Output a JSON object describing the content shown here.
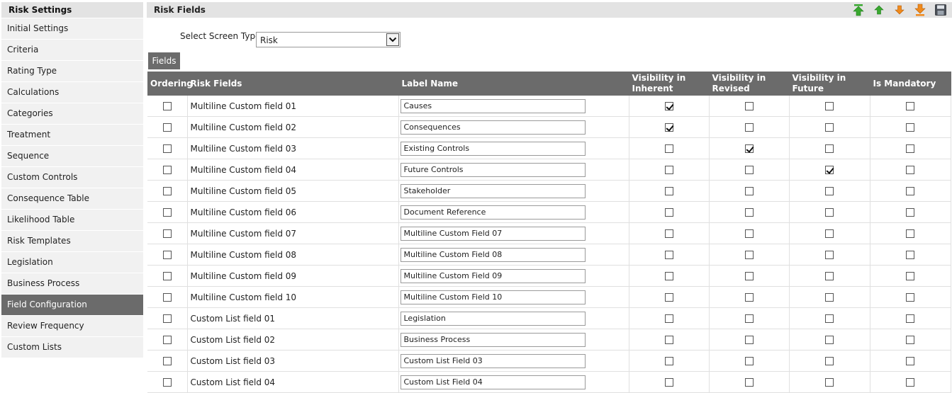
{
  "sidebar": {
    "title": "Risk Settings",
    "items": [
      {
        "label": "Initial Settings"
      },
      {
        "label": "Criteria"
      },
      {
        "label": "Rating Type"
      },
      {
        "label": "Calculations"
      },
      {
        "label": "Categories"
      },
      {
        "label": "Treatment"
      },
      {
        "label": "Sequence"
      },
      {
        "label": "Custom Controls"
      },
      {
        "label": "Consequence Table"
      },
      {
        "label": "Likelihood Table"
      },
      {
        "label": "Risk Templates"
      },
      {
        "label": "Legislation"
      },
      {
        "label": "Business Process"
      },
      {
        "label": "Field Configuration",
        "active": true
      },
      {
        "label": "Review Frequency"
      },
      {
        "label": "Custom Lists"
      }
    ]
  },
  "header": {
    "title": "Risk Fields",
    "toolbar_icons": [
      "move-top-icon",
      "move-up-icon",
      "move-down-icon",
      "move-bottom-icon",
      "save-icon"
    ]
  },
  "screen_type": {
    "label": "Select Screen Type :",
    "value": "Risk"
  },
  "tab": {
    "label": "Fields"
  },
  "table": {
    "headers": {
      "ordering": "Ordering",
      "risk_fields": "Risk Fields",
      "label_name": "Label Name",
      "vis_inherent": "Visibility in Inherent",
      "vis_revised": "Visibility in Revised",
      "vis_future": "Visibility in Future",
      "mandatory": "Is Mandatory"
    },
    "rows": [
      {
        "field": "Multiline Custom field 01",
        "label": "Causes",
        "inherent": true,
        "revised": false,
        "future": false,
        "mandatory": false
      },
      {
        "field": "Multiline Custom field 02",
        "label": "Consequences",
        "inherent": true,
        "revised": false,
        "future": false,
        "mandatory": false
      },
      {
        "field": "Multiline Custom field 03",
        "label": "Existing Controls",
        "inherent": false,
        "revised": true,
        "future": false,
        "mandatory": false
      },
      {
        "field": "Multiline Custom field 04",
        "label": "Future Controls",
        "inherent": false,
        "revised": false,
        "future": true,
        "mandatory": false
      },
      {
        "field": "Multiline Custom field 05",
        "label": "Stakeholder",
        "inherent": false,
        "revised": false,
        "future": false,
        "mandatory": false
      },
      {
        "field": "Multiline Custom field 06",
        "label": "Document Reference",
        "inherent": false,
        "revised": false,
        "future": false,
        "mandatory": false
      },
      {
        "field": "Multiline Custom field 07",
        "label": "Multiline Custom Field 07",
        "inherent": false,
        "revised": false,
        "future": false,
        "mandatory": false
      },
      {
        "field": "Multiline Custom field 08",
        "label": "Multiline Custom Field 08",
        "inherent": false,
        "revised": false,
        "future": false,
        "mandatory": false
      },
      {
        "field": "Multiline Custom field 09",
        "label": "Multiline Custom Field 09",
        "inherent": false,
        "revised": false,
        "future": false,
        "mandatory": false
      },
      {
        "field": "Multiline Custom field 10",
        "label": "Multiline Custom Field 10",
        "inherent": false,
        "revised": false,
        "future": false,
        "mandatory": false
      },
      {
        "field": "Custom List field 01",
        "label": "Legislation",
        "inherent": false,
        "revised": false,
        "future": false,
        "mandatory": false
      },
      {
        "field": "Custom List field 02",
        "label": "Business Process",
        "inherent": false,
        "revised": false,
        "future": false,
        "mandatory": false
      },
      {
        "field": "Custom List field 03",
        "label": "Custom List Field 03",
        "inherent": false,
        "revised": false,
        "future": false,
        "mandatory": false
      },
      {
        "field": "Custom List field 04",
        "label": "Custom List Field 04",
        "inherent": false,
        "revised": false,
        "future": false,
        "mandatory": false
      }
    ]
  },
  "colors": {
    "accent_header": "#6b6b6b",
    "panel": "#e3e3e3",
    "arrow_green": "#3aa830",
    "arrow_orange": "#f08a1c"
  }
}
